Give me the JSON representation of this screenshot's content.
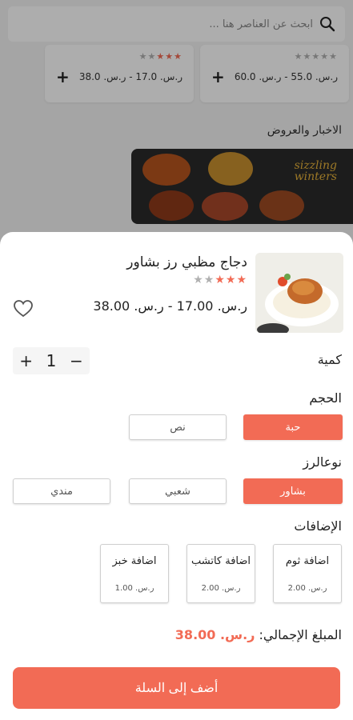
{
  "colors": {
    "accent": "#f26b55",
    "star_filled": "#f26b55",
    "star_empty": "#b0b0b0"
  },
  "background": {
    "search": {
      "placeholder": "ابحث عن العناصر هنا ...",
      "icon": "search-icon"
    },
    "cards": [
      {
        "price": "ر.س. 55.0 - ر.س. 60.0",
        "stars": "★★★★★",
        "rating": 0
      },
      {
        "price": "ر.س. 17.0 - ر.س. 38.0",
        "stars": "★★★★★",
        "rating": 3
      }
    ],
    "news_title": "الاخبار والعروض",
    "banner": {
      "line1": "sizzling",
      "line2": "winters"
    }
  },
  "product": {
    "name": "دجاج مظبي رز بشاور",
    "rating": 3,
    "stars": "★★★★★",
    "price": "ر.س. 17.00 - ر.س. 38.00"
  },
  "quantity": {
    "label": "كمية",
    "value": "1",
    "plus": "+",
    "minus": "−"
  },
  "size": {
    "label": "الحجم",
    "options": [
      "حبة",
      "نص"
    ],
    "selected": 0
  },
  "rice_type": {
    "label": "نوعالرز",
    "options": [
      "بشاور",
      "شعبي",
      "مندي"
    ],
    "selected": 0
  },
  "addons": {
    "label": "الإضافات",
    "items": [
      {
        "name": "اضافة ثوم",
        "price": "ر.س. 2.00"
      },
      {
        "name": "اضافة كاتشب",
        "price": "ر.س. 2.00"
      },
      {
        "name": "اضافة خبز",
        "price": "ر.س. 1.00"
      }
    ]
  },
  "total": {
    "label": "المبلغ الإجمالي:",
    "value": "ر.س. 38.00"
  },
  "cta": {
    "label": "أضف إلى السلة"
  }
}
